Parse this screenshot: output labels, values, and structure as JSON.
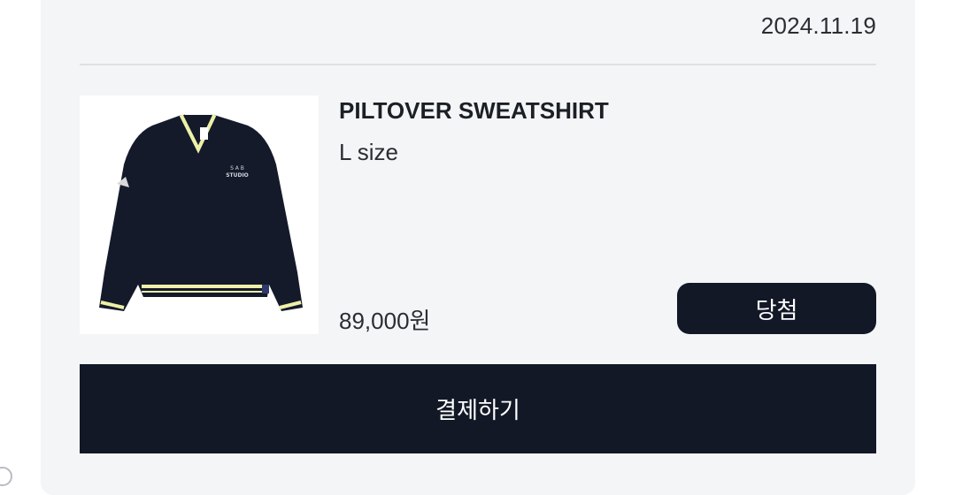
{
  "order": {
    "date": "2024.11.19"
  },
  "product": {
    "name": "PILTOVER SWEATSHIRT",
    "option": "L size",
    "price": "89,000원",
    "image_alt": "navy v-neck sweatshirt",
    "logo_text_line1": "S A B",
    "logo_text_line2": "STUDIO"
  },
  "actions": {
    "status_label": "당첨",
    "pay_label": "결제하기"
  },
  "colors": {
    "card_bg": "#f4f5f7",
    "button_dark": "#121826",
    "sweater_navy": "#141a2a",
    "trim_yellow": "#eef0a8"
  }
}
